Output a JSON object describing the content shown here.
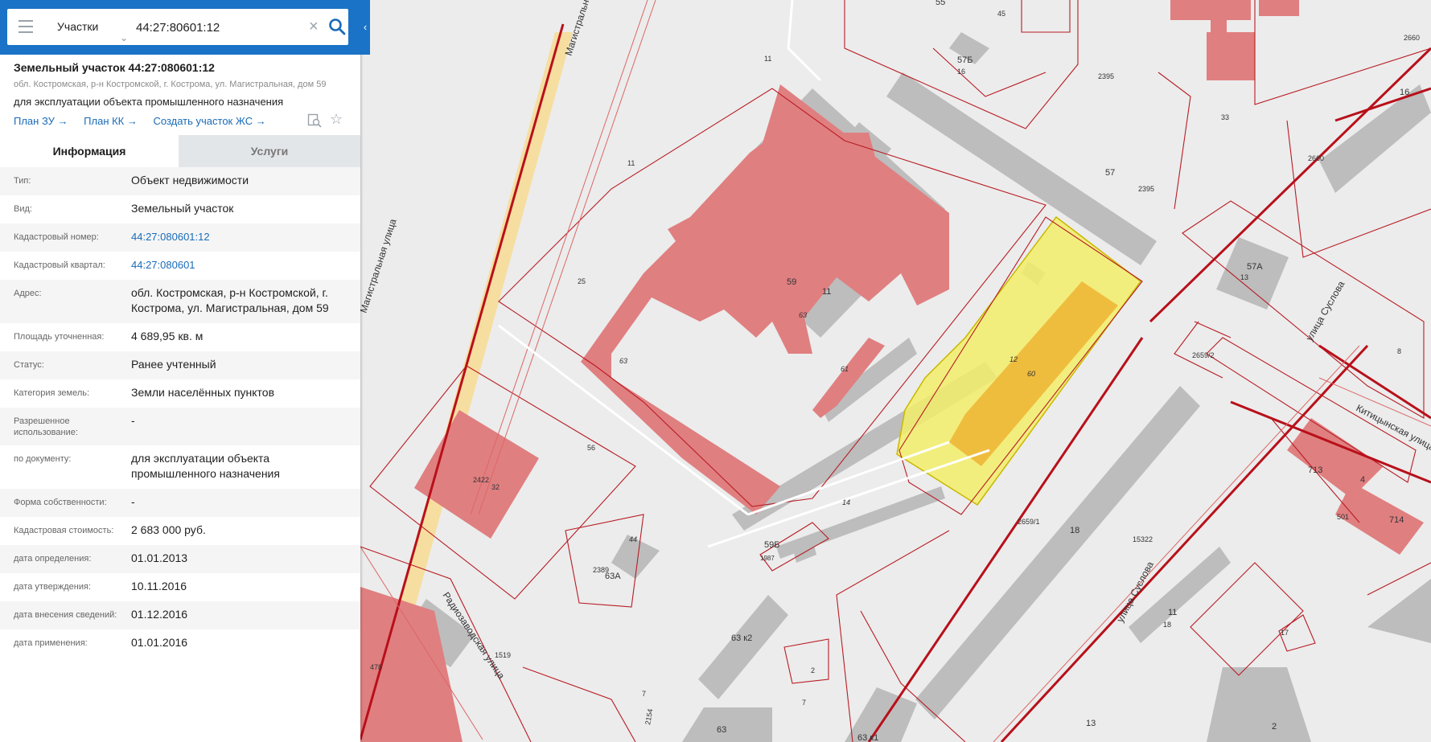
{
  "search": {
    "layer": "Участки",
    "query": "44:27:80601:12"
  },
  "object": {
    "title": "Земельный участок 44:27:080601:12",
    "address": "обл. Костромская, р-н Костромской, г. Кострома, ул. Магистральная, дом 59",
    "purpose": "для эксплуатации объекта промышленного назначения",
    "links": [
      "План ЗУ →",
      "План КК →",
      "Создать участок ЖС →"
    ]
  },
  "tabs": {
    "info": "Информация",
    "services": "Услуги"
  },
  "info": [
    {
      "key": "Тип:",
      "value": "Объект недвижимости"
    },
    {
      "key": "Вид:",
      "value": "Земельный участок"
    },
    {
      "key": "Кадастровый номер:",
      "value": "44:27:080601:12"
    },
    {
      "key": "Кадастровый квартал:",
      "value": "44:27:080601"
    },
    {
      "key": "Адрес:",
      "value": "обл. Костромская, р-н Костромской, г. Кострома, ул. Магистральная, дом 59"
    },
    {
      "key": "Площадь уточненная:",
      "value": "4 689,95 кв. м"
    },
    {
      "key": "Статус:",
      "value": "Ранее учтенный"
    },
    {
      "key": "Категория земель:",
      "value": "Земли населённых пунктов"
    },
    {
      "key": "Разрешенное использование:",
      "value": "-"
    },
    {
      "key": "по документу:",
      "value": "для эксплуатации объекта промышленного назначения"
    },
    {
      "key": "Форма собственности:",
      "value": "-"
    },
    {
      "key": "Кадастровая стоимость:",
      "value": "2 683 000 руб."
    },
    {
      "key": "дата определения:",
      "value": "01.01.2013"
    },
    {
      "key": "дата утверждения:",
      "value": "10.11.2016"
    },
    {
      "key": "дата внесения сведений:",
      "value": "01.12.2016"
    },
    {
      "key": "дата применения:",
      "value": "01.01.2016"
    }
  ],
  "map": {
    "streets": [
      "Магистральная улица",
      "Радиозаводская улица",
      "улица Суслова",
      "улица Суслова",
      "Китицынская улица"
    ],
    "house_labels": [
      "55",
      "45",
      "57Б",
      "16",
      "57",
      "57А",
      "13",
      "16",
      "59",
      "11",
      "63",
      "61",
      "12",
      "60",
      "14",
      "59Б",
      "18",
      "11",
      "18",
      "17",
      "63 к2",
      "63",
      "63 к1",
      "2",
      "7",
      "13",
      "2",
      "25",
      "63",
      "2422",
      "32",
      "63А",
      "44",
      "713",
      "4",
      "714",
      "478",
      "501"
    ],
    "parcel_labels": [
      "11",
      "11",
      "2395",
      "2395",
      "33",
      "2660",
      "2660",
      "8",
      "2659/2",
      "2659/1",
      "56",
      "15322",
      "1519",
      "2389",
      "1987",
      "2154",
      "7"
    ]
  }
}
